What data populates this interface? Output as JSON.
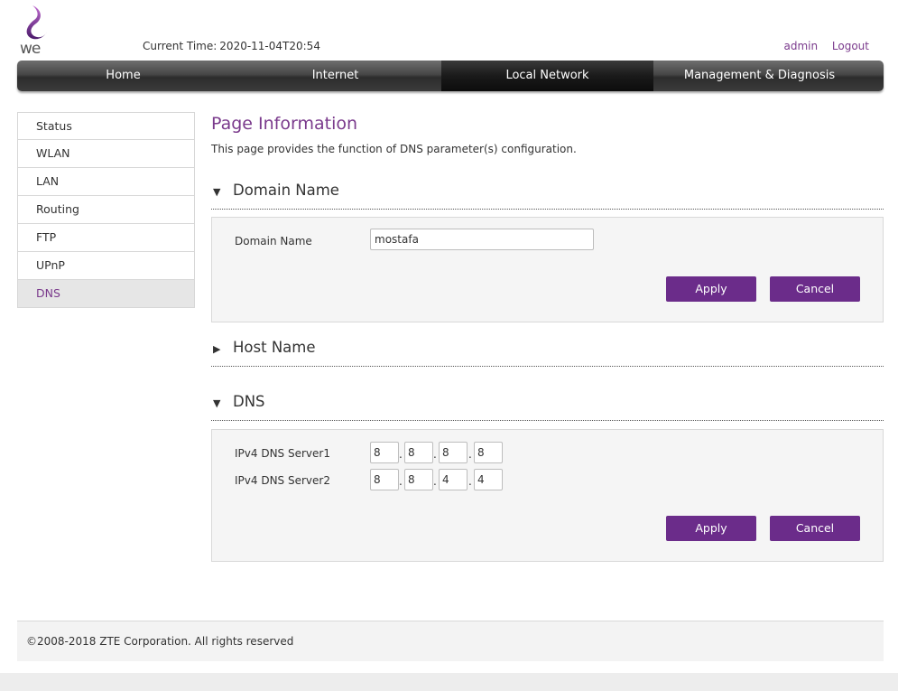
{
  "header": {
    "logo_text": "we",
    "current_time_label": "Current Time:",
    "current_time_value": "2020-11-04T20:54",
    "user": "admin",
    "logout": "Logout"
  },
  "nav": {
    "items": [
      "Home",
      "Internet",
      "Local Network",
      "Management & Diagnosis"
    ],
    "active": "Local Network"
  },
  "sidebar": {
    "items": [
      "Status",
      "WLAN",
      "LAN",
      "Routing",
      "FTP",
      "UPnP",
      "DNS"
    ],
    "active": "DNS"
  },
  "page": {
    "title": "Page Information",
    "description": "This page provides the function of DNS parameter(s) configuration."
  },
  "sections": {
    "domain": {
      "title": "Domain Name",
      "expanded": true,
      "field_label": "Domain Name",
      "field_value": "mostafa",
      "apply": "Apply",
      "cancel": "Cancel"
    },
    "host": {
      "title": "Host Name",
      "expanded": false
    },
    "dns": {
      "title": "DNS",
      "expanded": true,
      "server1_label": "IPv4 DNS Server1",
      "server1": [
        "8",
        "8",
        "8",
        "8"
      ],
      "server2_label": "IPv4 DNS Server2",
      "server2": [
        "8",
        "8",
        "4",
        "4"
      ],
      "apply": "Apply",
      "cancel": "Cancel"
    }
  },
  "icons": {
    "expanded": "▼",
    "collapsed": "▶"
  },
  "colors": {
    "brand_purple": "#6b2c8a",
    "link_purple": "#7a3a8c"
  },
  "footer": {
    "copyright": "©2008-2018 ZTE Corporation. All rights reserved"
  }
}
